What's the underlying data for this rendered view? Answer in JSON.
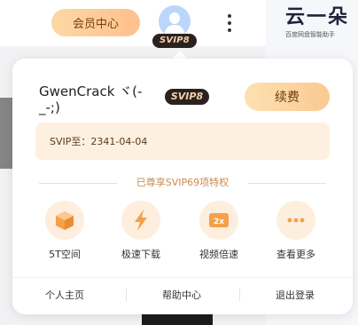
{
  "topbar": {
    "member_center_label": "会员中心",
    "avatar_badge": "SVIP8",
    "logo_text": "云一朵",
    "logo_subtext": "百度网盘智能助手"
  },
  "popup": {
    "username": "GwenCrack ヾ(-_-;)",
    "level_badge": "SVIP8",
    "renew_label": "续费",
    "expiry": "SVIP至：2341-04-04",
    "privilege_title": "已尊享SVIP69项特权",
    "features": [
      {
        "label": "5T空间",
        "icon": "box-icon"
      },
      {
        "label": "极速下载",
        "icon": "lightning-icon"
      },
      {
        "label": "视频倍速",
        "icon": "video-speed-icon"
      },
      {
        "label": "查看更多",
        "icon": "more-dots-icon"
      }
    ],
    "video_icon_text": "2x",
    "footer_links": [
      "个人主页",
      "帮助中心",
      "退出登录"
    ]
  },
  "colors": {
    "accent_gold": "#fbc990",
    "badge_dark": "#2b2220",
    "icon_orange": "#f5a04a"
  }
}
